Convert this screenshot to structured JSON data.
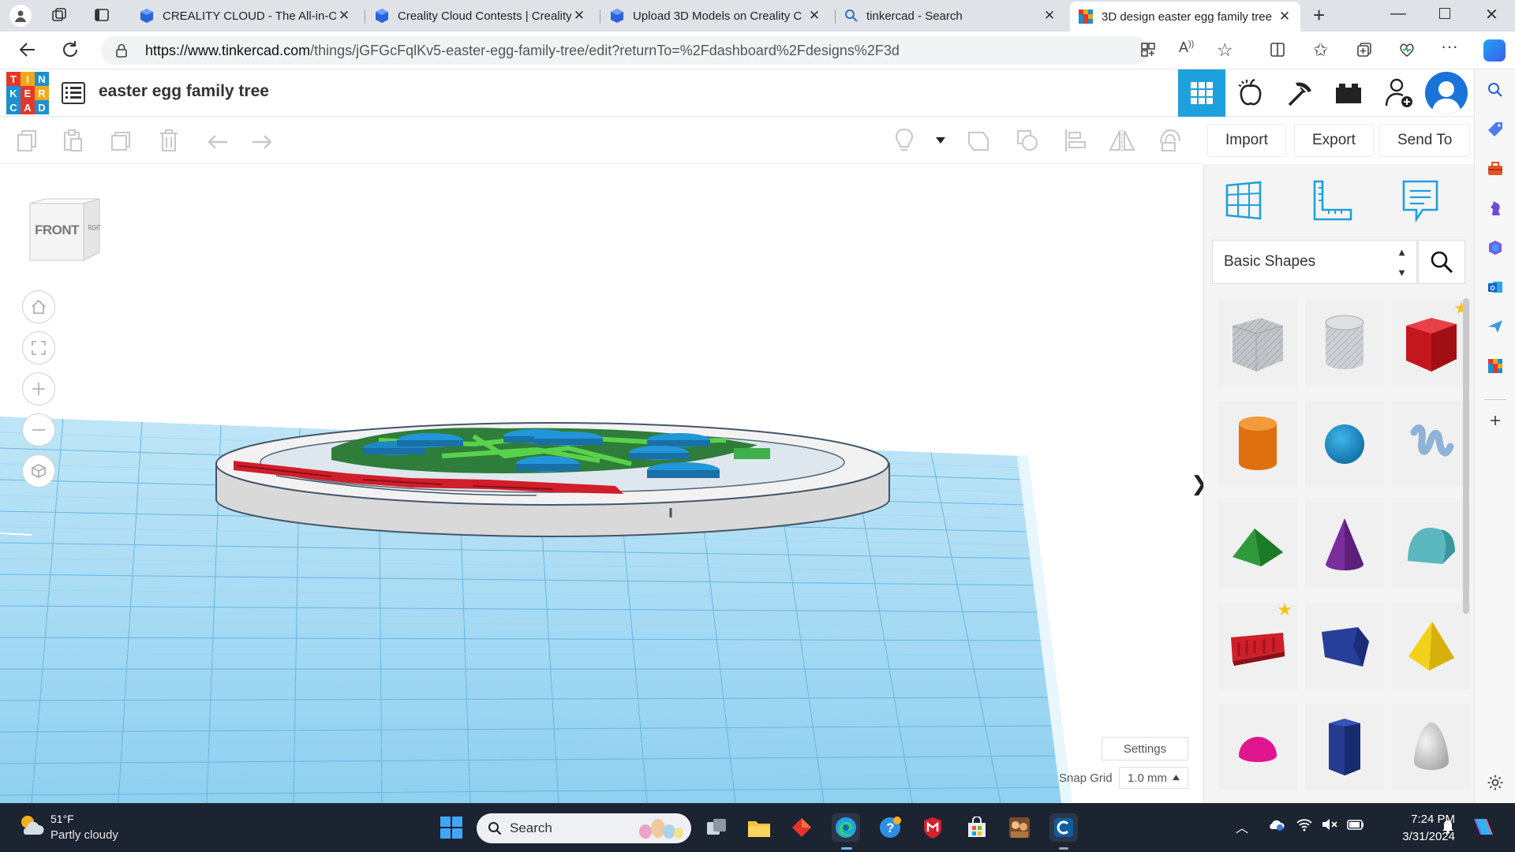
{
  "browser": {
    "tabs": [
      {
        "title": "CREALITY CLOUD - The All-in-On",
        "icon": "creality-icon",
        "active": false
      },
      {
        "title": "Creality Cloud Contests | Creality",
        "icon": "creality-icon",
        "active": false
      },
      {
        "title": "Upload 3D Models on Creality C",
        "icon": "creality-icon",
        "active": false
      },
      {
        "title": "tinkercad - Search",
        "icon": "search-icon",
        "active": false
      },
      {
        "title": "3D design easter egg family tree",
        "icon": "tinkercad-icon",
        "active": true
      }
    ],
    "url_host": "https://www.tinkercad.com",
    "url_path": "/things/jGFGcFqlKv5-easter-egg-family-tree/edit?returnTo=%2Fdashboard%2Fdesigns%2F3d"
  },
  "app": {
    "logo_letters": [
      "T",
      "I",
      "N",
      "K",
      "E",
      "R",
      "C",
      "A",
      "D"
    ],
    "logo_colors": [
      "#e3372a",
      "#f2a71b",
      "#1d8fd1",
      "#1d8fd1",
      "#e3372a",
      "#f2a71b",
      "#1d8fd1",
      "#e3372a",
      "#1d8fd1"
    ],
    "design_title": "easter egg family tree",
    "accent": "#1ea0dc"
  },
  "toolbar": {
    "import_label": "Import",
    "export_label": "Export",
    "send_to_label": "Send To"
  },
  "viewcube": {
    "front": "FRONT",
    "right": "RIGHT"
  },
  "panel": {
    "library": "Basic Shapes",
    "shapes": [
      {
        "name": "box-hole",
        "color": "#b9bec4"
      },
      {
        "name": "cylinder-hole",
        "color": "#c4c7cb"
      },
      {
        "name": "box",
        "color": "#e0202a",
        "favorite": true
      },
      {
        "name": "cylinder",
        "color": "#ec7a12"
      },
      {
        "name": "sphere",
        "color": "#1b8fc8"
      },
      {
        "name": "scribble",
        "color": "#8fb3d6"
      },
      {
        "name": "roof",
        "color": "#2e9a3b"
      },
      {
        "name": "cone",
        "color": "#7a2d9c"
      },
      {
        "name": "round-roof",
        "color": "#59b6bd"
      },
      {
        "name": "text",
        "color": "#d11f2a",
        "favorite": true
      },
      {
        "name": "wedge",
        "color": "#283f9a"
      },
      {
        "name": "pyramid",
        "color": "#f3d11a"
      },
      {
        "name": "half-sphere",
        "color": "#e0168f"
      },
      {
        "name": "polygon",
        "color": "#243b8f"
      },
      {
        "name": "paraboloid",
        "color": "#c8c8c8"
      }
    ]
  },
  "workplane": {
    "settings_label": "Settings",
    "snap_label": "Snap Grid",
    "snap_value": "1.0 mm"
  },
  "taskbar": {
    "temperature": "51°F",
    "weather": "Partly cloudy",
    "search_placeholder": "Search",
    "time": "7:24 PM",
    "date": "3/31/2024"
  }
}
